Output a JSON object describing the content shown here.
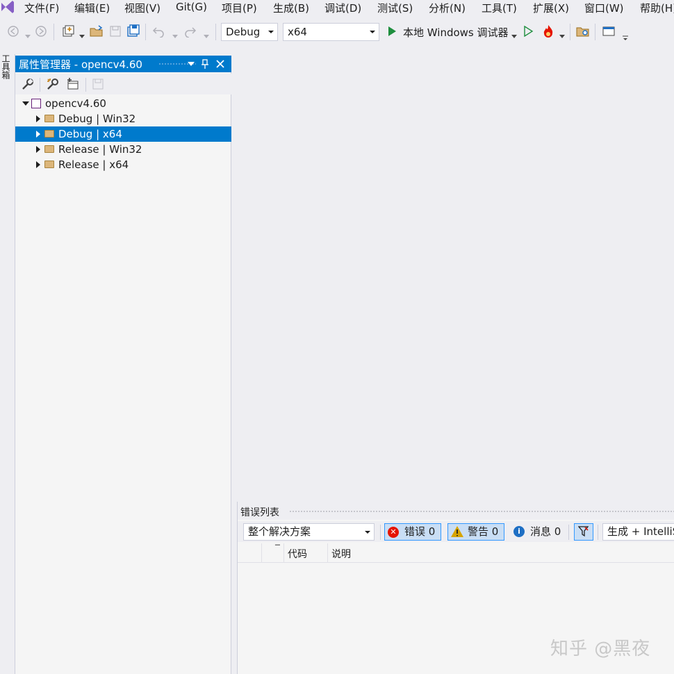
{
  "menu": {
    "items": [
      "文件(F)",
      "编辑(E)",
      "视图(V)",
      "Git(G)",
      "项目(P)",
      "生成(B)",
      "调试(D)",
      "测试(S)",
      "分析(N)",
      "工具(T)",
      "扩展(X)",
      "窗口(W)",
      "帮助(H)"
    ]
  },
  "toolbar": {
    "config_value": "Debug",
    "platform_value": "x64",
    "debugger_label": "本地 Windows 调试器"
  },
  "toolbox": {
    "label": "工具箱"
  },
  "property_manager": {
    "title": "属性管理器 - opencv4.60",
    "project_name": "opencv4.60",
    "configs": [
      "Debug | Win32",
      "Debug | x64",
      "Release | Win32",
      "Release | x64"
    ],
    "selected_index": 1
  },
  "error_list": {
    "title": "错误列表",
    "scope_value": "整个解决方案",
    "errors_label": "错误 0",
    "warnings_label": "警告 0",
    "messages_label": "消息 0",
    "source_value": "生成 + IntelliS",
    "columns": [
      "代码",
      "说明"
    ]
  },
  "watermark": "知乎 @黑夜",
  "colors": {
    "accent": "#007acc",
    "selection": "#007acc",
    "error_red": "#e51400",
    "warning_amber": "#d7a400",
    "info_blue": "#1e6fc4",
    "run_green": "#1e8e3e"
  }
}
